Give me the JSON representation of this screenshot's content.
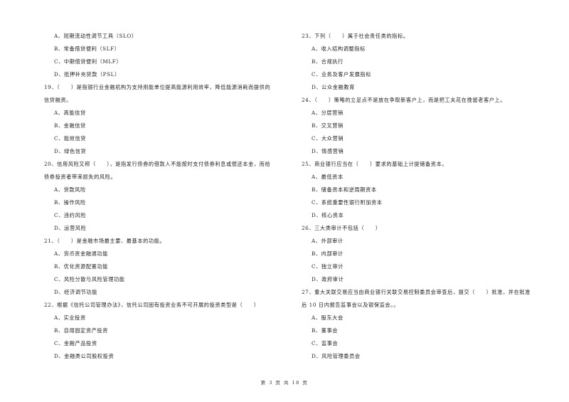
{
  "left_column": [
    {
      "type": "opt",
      "text": "A、短期流动性调节工具（SLO）"
    },
    {
      "type": "opt",
      "text": "B、常备借贷便利（SLF）"
    },
    {
      "type": "opt",
      "text": "C、中期借贷便利（MLF）"
    },
    {
      "type": "opt",
      "text": "D、抵押补充贷款（PSL）"
    },
    {
      "type": "q",
      "text": "19、（　　）是指银行业金融机构为支持用能单位提高能源利用效率，降低能源消耗而提供的"
    },
    {
      "type": "q",
      "text": "信贷融资。"
    },
    {
      "type": "opt",
      "text": "A、高能信贷"
    },
    {
      "type": "opt",
      "text": "B、金融信贷"
    },
    {
      "type": "opt",
      "text": "C、能效信贷"
    },
    {
      "type": "opt",
      "text": "D、绿色信贷"
    },
    {
      "type": "q",
      "text": "20、信用风险又称（　　），是指发行债券的借款人不能按时支付债券利息或偿还本金，而给"
    },
    {
      "type": "q",
      "text": "债券投资者带来损失的风险。"
    },
    {
      "type": "opt",
      "text": "A、贷款风险"
    },
    {
      "type": "opt",
      "text": "B、操作风险"
    },
    {
      "type": "opt",
      "text": "C、违约风险"
    },
    {
      "type": "opt",
      "text": "D、运营风险"
    },
    {
      "type": "q",
      "text": "21、（　　）是金融市场最主要、最基本的功能。"
    },
    {
      "type": "opt",
      "text": "A、货币资金融通功能"
    },
    {
      "type": "opt",
      "text": "B、优化资源配置功能"
    },
    {
      "type": "opt",
      "text": "C、风险分散与风险管理功能"
    },
    {
      "type": "opt",
      "text": "D、经济调节功能"
    },
    {
      "type": "q",
      "text": "22、根据《信托公司管理办法》，信托公司固有投资业务不可开展的投资类型是（　　）"
    },
    {
      "type": "opt",
      "text": "A、实业投资"
    },
    {
      "type": "opt",
      "text": "B、自用固定资产投资"
    },
    {
      "type": "opt",
      "text": "C、金融产品投资"
    },
    {
      "type": "opt",
      "text": "D、金融类公司股权投资"
    }
  ],
  "right_column": [
    {
      "type": "q",
      "text": "23、下列（　　）属于社会责任类的指标。"
    },
    {
      "type": "opt",
      "text": "A、收入结构调整指标"
    },
    {
      "type": "opt",
      "text": "B、合规执行"
    },
    {
      "type": "opt",
      "text": "C、业务及客户发展指标"
    },
    {
      "type": "opt",
      "text": "D、公众金融教育"
    },
    {
      "type": "q",
      "text": "24、（　　）策略的立足点不是放在争取新客户上，而是把工夫花在挽留老客户上。"
    },
    {
      "type": "opt",
      "text": "A、分层营销"
    },
    {
      "type": "opt",
      "text": "B、交叉营销"
    },
    {
      "type": "opt",
      "text": "C、大众营销"
    },
    {
      "type": "opt",
      "text": "D、情感营销"
    },
    {
      "type": "q",
      "text": "25、商业银行应当在（　　）要求的基础上计提储备资本。"
    },
    {
      "type": "opt",
      "text": "A、最低资本"
    },
    {
      "type": "opt",
      "text": "B、储备资本和逆周期资本"
    },
    {
      "type": "opt",
      "text": "C、系统重要性银行附加资本"
    },
    {
      "type": "opt",
      "text": "D、核心资本"
    },
    {
      "type": "q",
      "text": "26、三大类审计不包括（　　）"
    },
    {
      "type": "opt",
      "text": "A、外部审计"
    },
    {
      "type": "opt",
      "text": "B、内部审计"
    },
    {
      "type": "opt",
      "text": "C、独立审计"
    },
    {
      "type": "opt",
      "text": "D、政府审计"
    },
    {
      "type": "q",
      "text": "27、重大关联交易应当由商业银行关联交易控制委员会审查后，提交（　　）批准，并在批准"
    },
    {
      "type": "q",
      "text": "后 10 日内报告监事会以及银保监会。。"
    },
    {
      "type": "opt",
      "text": "A、股东大会"
    },
    {
      "type": "opt",
      "text": "B、董事会"
    },
    {
      "type": "opt",
      "text": "C、监事会"
    },
    {
      "type": "opt",
      "text": "D、风险管理委员会"
    }
  ],
  "footer": {
    "page_label": "第 3 页 共 18 页"
  }
}
